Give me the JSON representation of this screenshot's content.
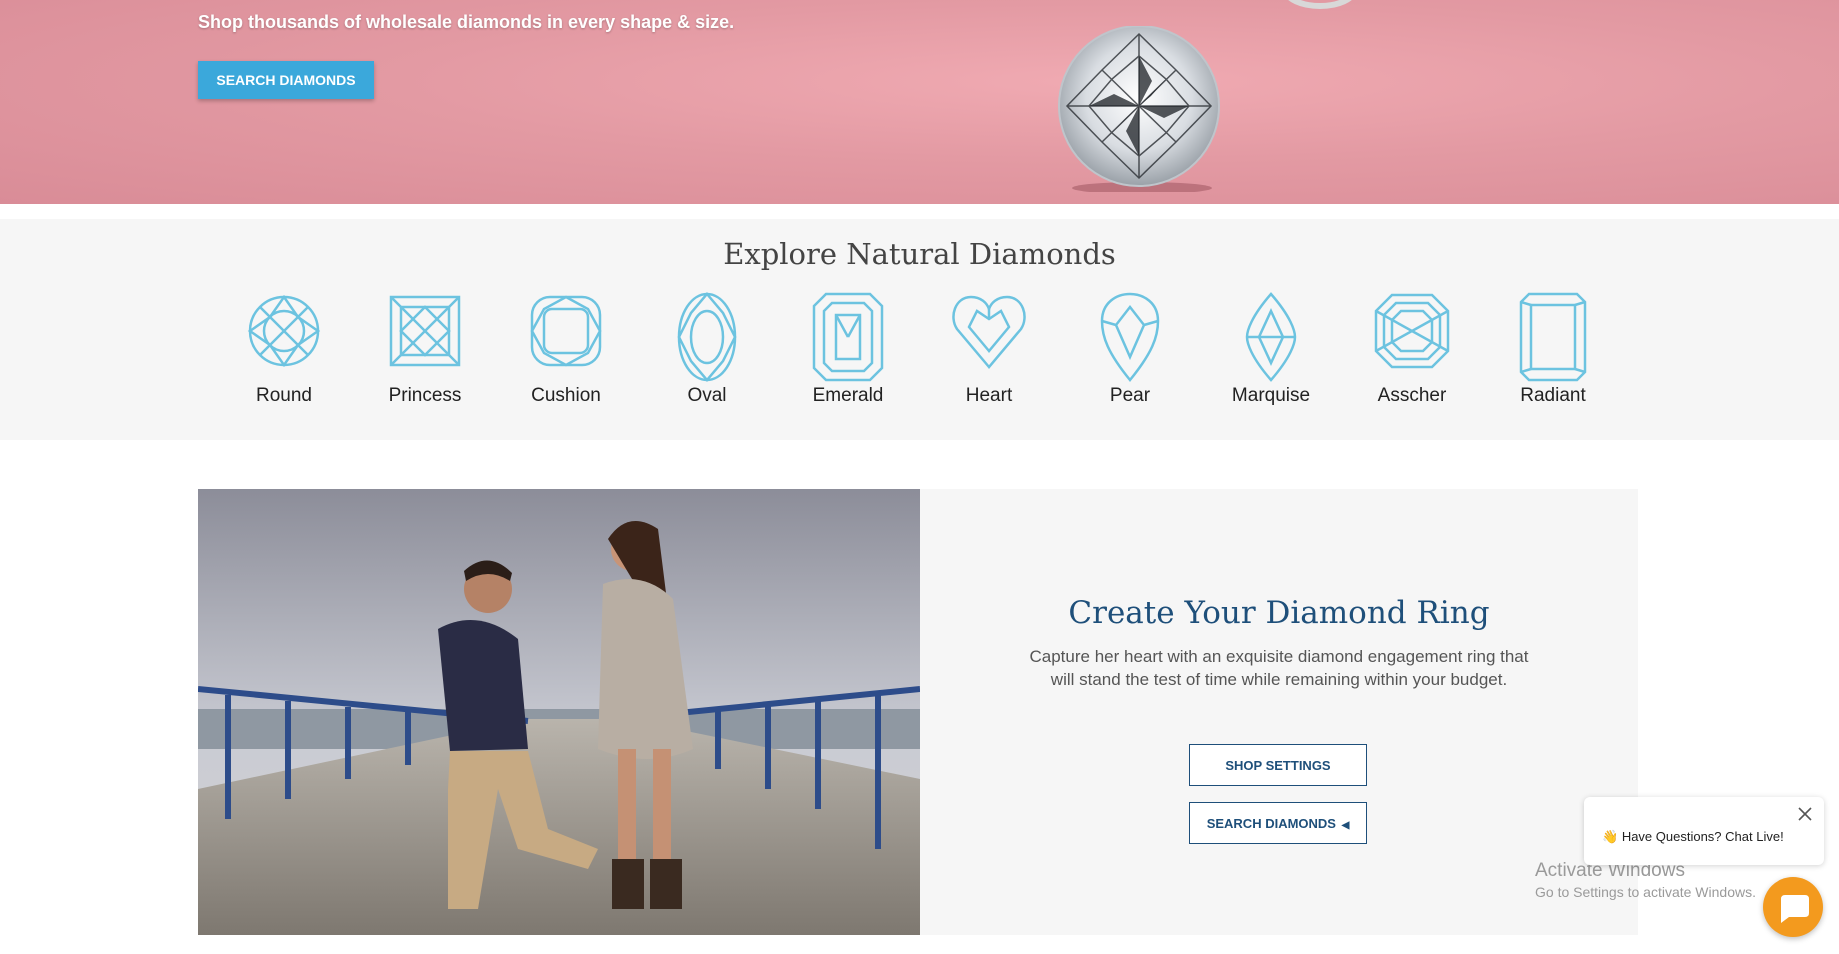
{
  "hero": {
    "tagline": "Shop thousands of wholesale diamonds in every shape & size.",
    "button_label": "SEARCH DIAMONDS"
  },
  "shapes": {
    "title": "Explore Natural Diamonds",
    "items": [
      {
        "label": "Round",
        "icon": "round-diamond-icon"
      },
      {
        "label": "Princess",
        "icon": "princess-diamond-icon"
      },
      {
        "label": "Cushion",
        "icon": "cushion-diamond-icon"
      },
      {
        "label": "Oval",
        "icon": "oval-diamond-icon"
      },
      {
        "label": "Emerald",
        "icon": "emerald-diamond-icon"
      },
      {
        "label": "Heart",
        "icon": "heart-diamond-icon"
      },
      {
        "label": "Pear",
        "icon": "pear-diamond-icon"
      },
      {
        "label": "Marquise",
        "icon": "marquise-diamond-icon"
      },
      {
        "label": "Asscher",
        "icon": "asscher-diamond-icon"
      },
      {
        "label": "Radiant",
        "icon": "radiant-diamond-icon"
      }
    ],
    "icon_color": "#6cc3e0"
  },
  "ring": {
    "title": "Create Your Diamond Ring",
    "description": "Capture her heart with an exquisite diamond engagement ring that will stand the test of time while remaining within your budget.",
    "shop_settings_label": "SHOP SETTINGS",
    "search_diamonds_label": "SEARCH DIAMONDS"
  },
  "chat": {
    "prompt": "Have Questions? Chat Live!",
    "emoji": "👋",
    "bubble_color": "#f39a1e"
  },
  "watermark": {
    "title": "Activate Windows",
    "subtitle": "Go to Settings to activate Windows."
  },
  "colors": {
    "accent": "#3ba8db",
    "navy": "#1e4f7a",
    "hero_bg": "#e39aa3"
  }
}
